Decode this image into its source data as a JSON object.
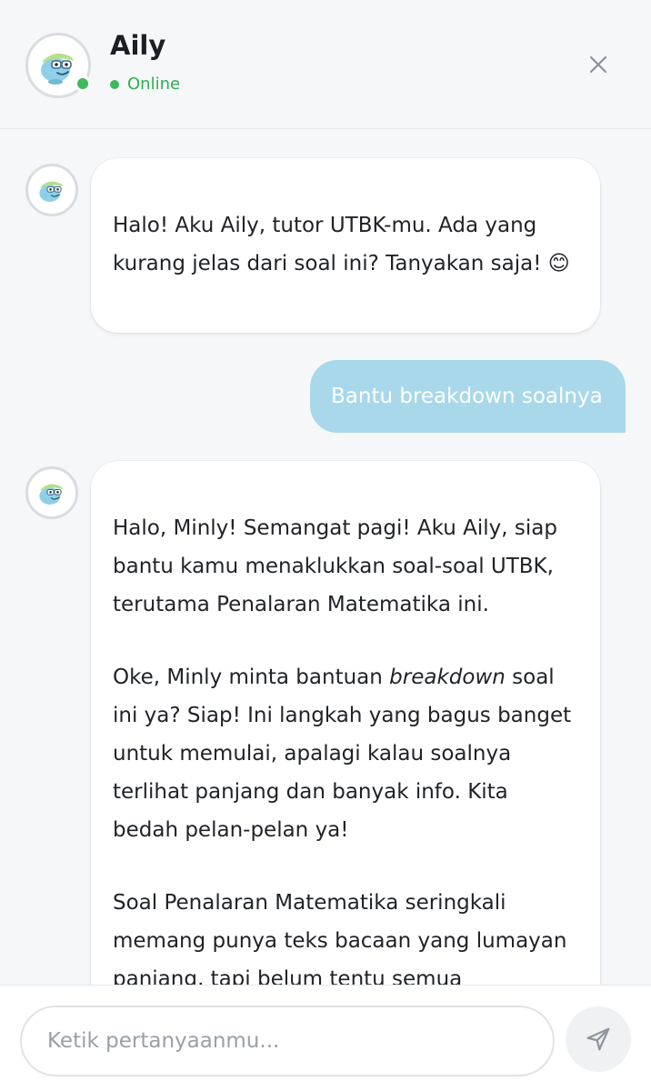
{
  "header": {
    "bot_name": "Aily",
    "status": "Online"
  },
  "messages": [
    {
      "role": "bot",
      "paragraphs": [
        "Halo! Aku Aily, tutor UTBK-mu. Ada yang kurang jelas dari soal ini? Tanyakan saja! 😊"
      ]
    },
    {
      "role": "user",
      "text": "Bantu breakdown soalnya"
    },
    {
      "role": "bot",
      "p1": "Halo, Minly! Semangat pagi! Aku Aily, siap bantu kamu menaklukkan soal-soal UTBK, terutama Penalaran Matematika ini.",
      "p2_before": "Oke, Minly minta bantuan ",
      "p2_em": "breakdown",
      "p2_after": " soal ini ya? Siap! Ini langkah yang bagus banget untuk memulai, apalagi kalau soalnya terlihat panjang dan banyak info. Kita bedah pelan-pelan ya!",
      "p3": "Soal Penalaran Matematika seringkali memang punya teks bacaan yang lumayan panjang, tapi belum tentu semua"
    }
  ],
  "input": {
    "placeholder": "Ketik pertanyaanmu..."
  },
  "icons": {
    "avatar": "turtle-mascot-icon",
    "close": "close-icon",
    "send": "send-icon"
  },
  "colors": {
    "online": "#3fb95d",
    "user_bubble": "#a8d8ea"
  }
}
